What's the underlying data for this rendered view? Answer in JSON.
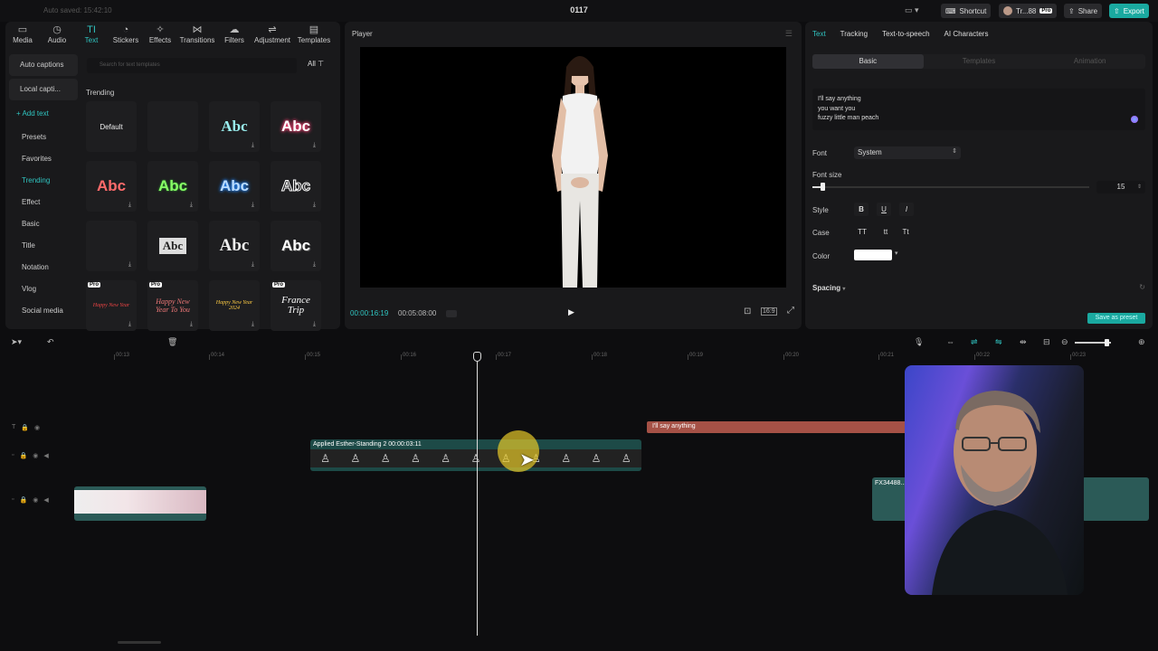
{
  "topbar": {
    "autosave": "Auto saved: 15:42:10",
    "project_title": "0117",
    "shortcut_label": "Shortcut",
    "account_label": "Tr...88",
    "account_badge": "Pro",
    "share_label": "Share",
    "export_label": "Export"
  },
  "media_tabs": [
    {
      "label": "Media",
      "icon": "media-icon"
    },
    {
      "label": "Audio",
      "icon": "audio-icon"
    },
    {
      "label": "Text",
      "icon": "text-icon"
    },
    {
      "label": "Stickers",
      "icon": "stickers-icon"
    },
    {
      "label": "Effects",
      "icon": "effects-icon"
    },
    {
      "label": "Transitions",
      "icon": "transitions-icon"
    },
    {
      "label": "Filters",
      "icon": "filters-icon"
    },
    {
      "label": "Adjustment",
      "icon": "adjustment-icon"
    },
    {
      "label": "Templates",
      "icon": "templates-icon"
    }
  ],
  "sidebar": {
    "auto_captions": "Auto captions",
    "local_captions": "Local capti...",
    "add_text": "+ Add text",
    "items": [
      "Presets",
      "Favorites",
      "Trending",
      "Effect",
      "Basic",
      "Title",
      "Notation",
      "Vlog",
      "Social media"
    ]
  },
  "text_library": {
    "search_placeholder": "Search for text templates",
    "filter_label": "All",
    "section_title": "Trending",
    "default_label": "Default",
    "sample_text": "Abc",
    "pro_badge": "Pro",
    "template_1": "Happy New Year",
    "template_2": "Happy New Year To You",
    "template_3": "Happy New Year 2024",
    "template_4": "France Trip"
  },
  "player": {
    "title": "Player",
    "current_time": "00:00:16:19",
    "total_time": "00:05:08:00",
    "ratio": "16:9"
  },
  "inspector": {
    "tabs": [
      "Text",
      "Tracking",
      "Text-to-speech",
      "AI Characters"
    ],
    "subtabs": [
      "Basic",
      "Templates",
      "Animation"
    ],
    "text_lines": [
      "I'll say anything",
      "you want you",
      "fuzzy little man peach"
    ],
    "font_label": "Font",
    "font_value": "System",
    "font_size_label": "Font size",
    "font_size_value": "15",
    "font_size_fraction": 0.03,
    "style_label": "Style",
    "style_buttons": [
      "B",
      "U",
      "I"
    ],
    "case_label": "Case",
    "case_buttons": [
      "TT",
      "tt",
      "Tt"
    ],
    "color_label": "Color",
    "color_value": "#ffffff",
    "spacing_label": "Spacing",
    "save_preset_label": "Save as preset"
  },
  "timeline": {
    "ticks": [
      "00:13",
      "00:14",
      "00:15",
      "00:16",
      "00:17",
      "00:18",
      "00:19",
      "00:20",
      "00:21",
      "00:22",
      "00:23"
    ],
    "text_clip": "I'll say anything",
    "video_clip": "Applied  Esther-Standing 2  00:00:03:11",
    "fx_clip": "FX34488..."
  },
  "colors": {
    "accent": "#30c4c0",
    "text_clip": "#a55146",
    "video_clip": "#1d4a47"
  }
}
